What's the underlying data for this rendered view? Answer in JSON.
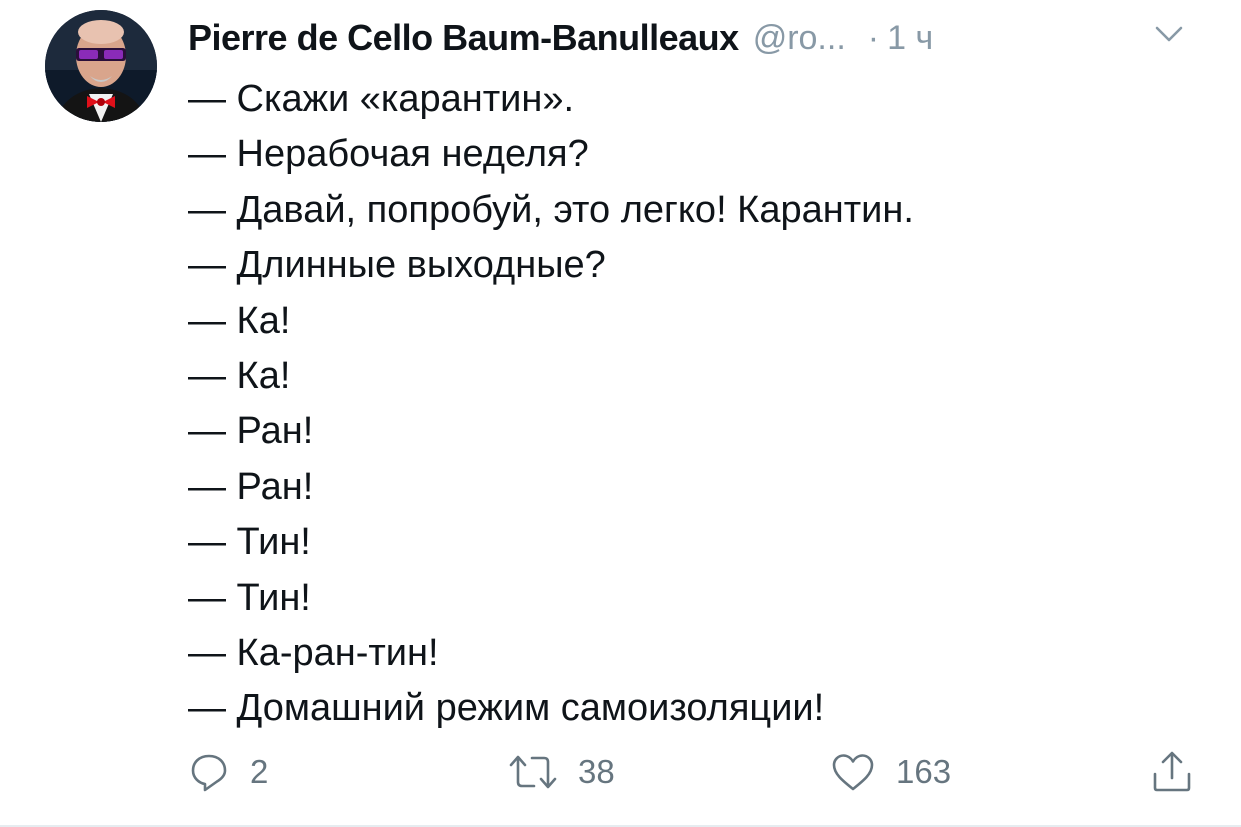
{
  "tweet": {
    "author": {
      "display_name": "Pierre de Cello Baum-Banulleaux",
      "handle": "@ro...",
      "avatar_icon": "avatar-portrait-icon"
    },
    "separator": "·",
    "time": "1 ч",
    "lines": [
      "— Скажи «карантин».",
      "— Нерабочая неделя?",
      "— Давай, попробуй, это легко! Карантин.",
      "— Длинные выходные?",
      "— Ка!",
      "— Ка!",
      "— Ран!",
      "— Ран!",
      "— Тин!",
      "— Тин!",
      "— Ка-ран-тин!",
      "— Домашний режим самоизоляции!"
    ],
    "actions": {
      "reply": {
        "icon": "reply-icon",
        "count": "2"
      },
      "retweet": {
        "icon": "retweet-icon",
        "count": "38"
      },
      "like": {
        "icon": "heart-icon",
        "count": "163"
      },
      "share": {
        "icon": "share-icon"
      }
    }
  },
  "colors": {
    "text": "#0f1419",
    "muted": "#8899a6",
    "action_gray": "#66757f",
    "divider": "#e6ecf0"
  }
}
